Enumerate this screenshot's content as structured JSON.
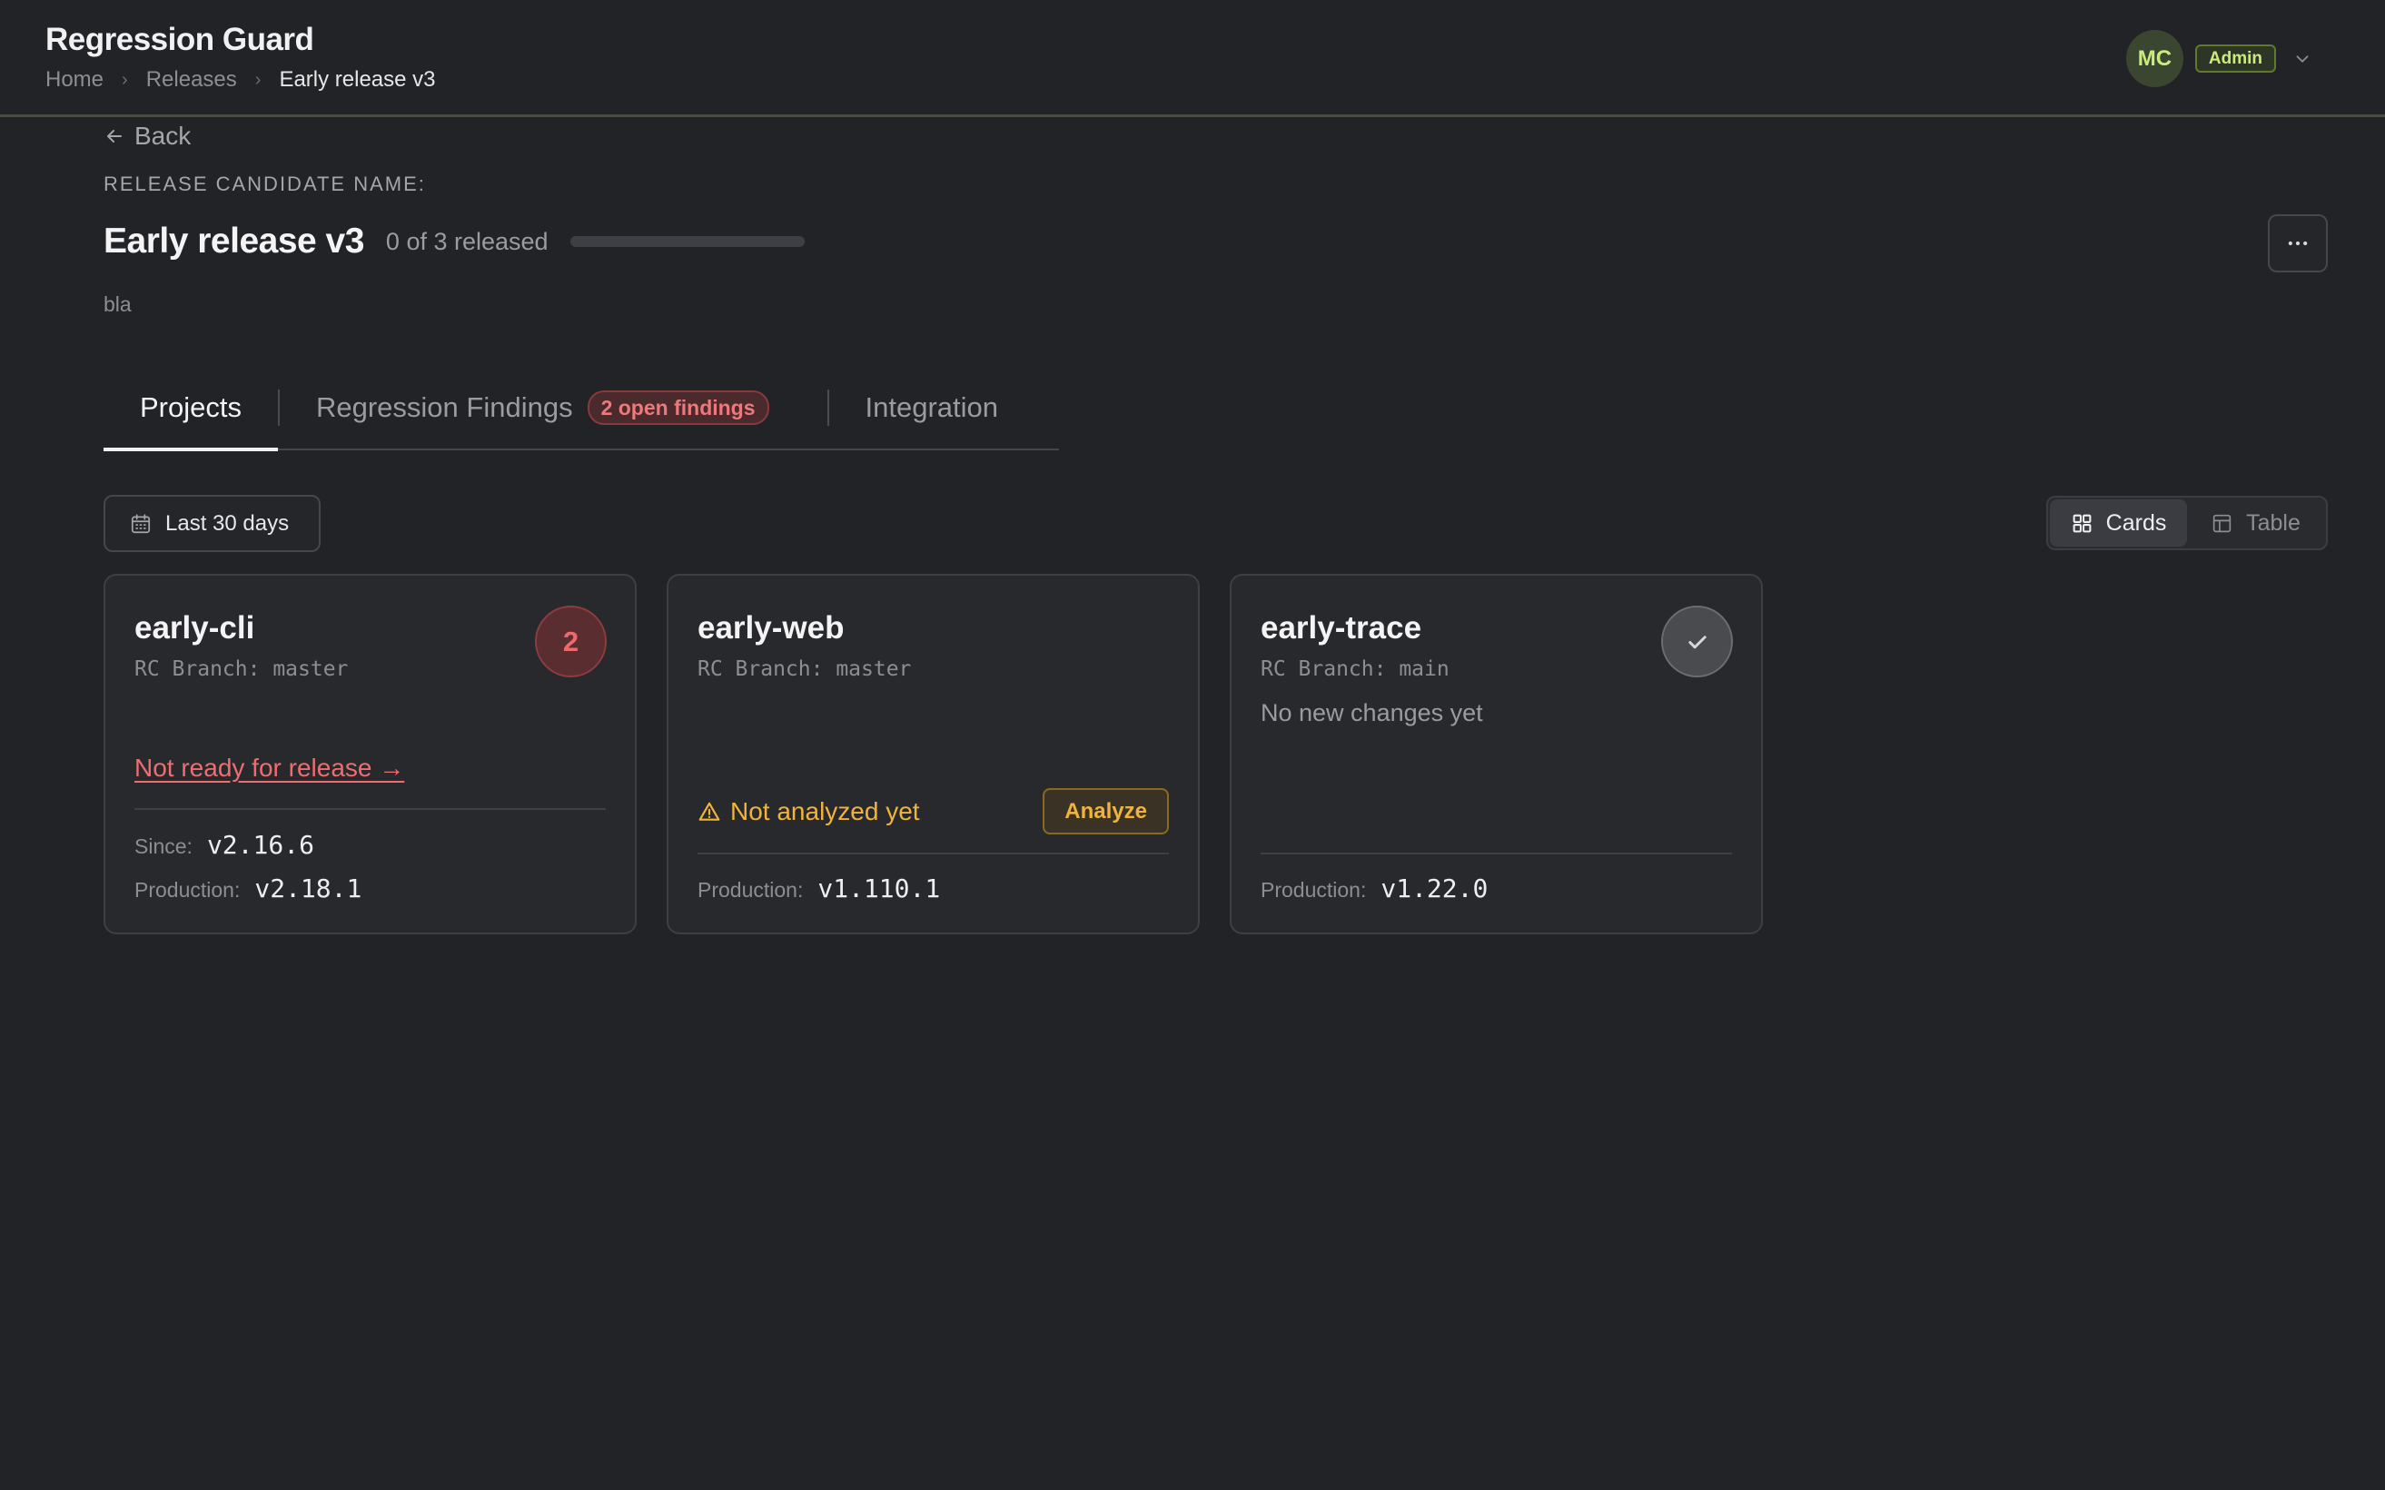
{
  "header": {
    "app_title": "Regression Guard",
    "breadcrumb": [
      "Home",
      "Releases",
      "Early release v3"
    ],
    "user": {
      "initials": "MC",
      "role": "Admin"
    }
  },
  "page": {
    "back_label": "Back",
    "rc_label": "Release Candidate Name:",
    "title": "Early release v3",
    "progress_text": "0 of 3 released",
    "progress": {
      "released": 0,
      "total": 3,
      "fraction": 0.0
    },
    "description": "bla"
  },
  "tabs": [
    {
      "label": "Projects",
      "active": true
    },
    {
      "label": "Regression Findings",
      "badge": "2 open findings",
      "active": false
    },
    {
      "label": "Integration",
      "active": false
    }
  ],
  "filters": {
    "date_range": "Last 30 days"
  },
  "view_toggle": {
    "cards": "Cards",
    "table": "Table",
    "selected": "Cards"
  },
  "projects": [
    {
      "name": "early-cli",
      "branch": "RC Branch: master",
      "findings_count": "2",
      "status": "Not ready for release →",
      "since_label": "Since:",
      "since": "v2.16.6",
      "production_label": "Production:",
      "production": "v2.18.1"
    },
    {
      "name": "early-web",
      "branch": "RC Branch: master",
      "status": "Not analyzed yet",
      "action": "Analyze",
      "production_label": "Production:",
      "production": "v1.110.1"
    },
    {
      "name": "early-trace",
      "branch": "RC Branch: main",
      "note": "No new changes yet",
      "production_label": "Production:",
      "production": "v1.22.0"
    }
  ],
  "colors": {
    "background": "#222326",
    "accent_green": "#c9ec7a",
    "danger": "#ef6d70",
    "warning": "#f0b43c"
  },
  "icons": [
    "chevron-right-icon",
    "chevron-down-icon",
    "arrow-left-icon",
    "more-horizontal-icon",
    "calendar-icon",
    "grid-icon",
    "table-icon",
    "warning-icon",
    "check-icon"
  ]
}
